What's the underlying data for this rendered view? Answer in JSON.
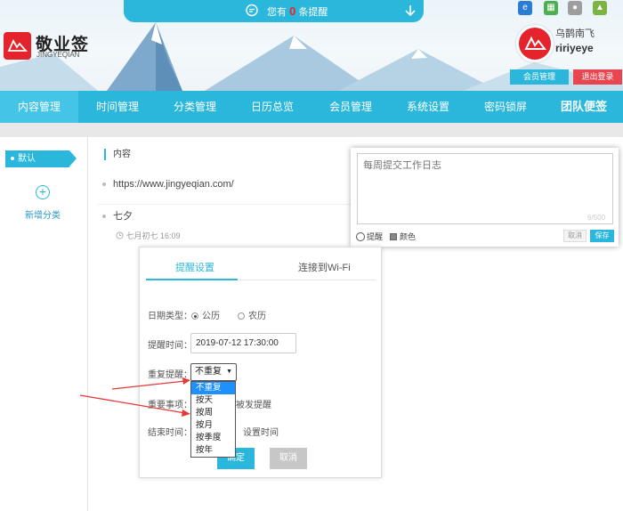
{
  "notice": {
    "prefix": "您有",
    "count": "0",
    "suffix": "条提醒"
  },
  "brand": {
    "name": "敬业签",
    "en": "JINGYEQIAN"
  },
  "os_icons": [
    "ie-icon",
    "windows-icon",
    "apple-icon",
    "android-icon"
  ],
  "user": {
    "name_cn": "乌鹊南飞",
    "name_en": "ririyeye",
    "member_btn": "会员管理",
    "logout_btn": "退出登录"
  },
  "nav": [
    "内容管理",
    "时间管理",
    "分类管理",
    "日历总览",
    "会员管理",
    "系统设置",
    "密码锁屏",
    "团队便签"
  ],
  "sidebar": {
    "default_cat": "默认",
    "add_label": "新增分类",
    "add_symbol": "+"
  },
  "list": {
    "header": "内容",
    "items": [
      {
        "text": "https://www.jingyeqian.com/"
      },
      {
        "text": "七夕",
        "time": "七月初七 16:09"
      }
    ]
  },
  "editor": {
    "placeholder": "每周提交工作日志",
    "counter": "6/500",
    "remind": "提醒",
    "color": "颜色",
    "cancel": "取消",
    "save": "保存"
  },
  "popup": {
    "tabs": [
      "提醒设置",
      "连接到Wi-Fi"
    ],
    "date_type_label": "日期类型：",
    "date_types": [
      "公历",
      "农历"
    ],
    "remind_time_label": "提醒时间：",
    "remind_time_value": "2019-07-12 17:30:00",
    "repeat_label": "重复提醒：",
    "repeat_value": "不重复",
    "important_label": "重要事项：",
    "important_partial": "被发提醒",
    "end_label": "结束时间：",
    "end_partial": "设置时间",
    "ok": "确定",
    "cancel": "取消",
    "options": [
      "不重复",
      "按天",
      "按周",
      "按月",
      "按季度",
      "按年"
    ]
  },
  "colors": {
    "accent": "#2bb7dc",
    "brand_red": "#e5232c",
    "logout": "#e8454f"
  }
}
